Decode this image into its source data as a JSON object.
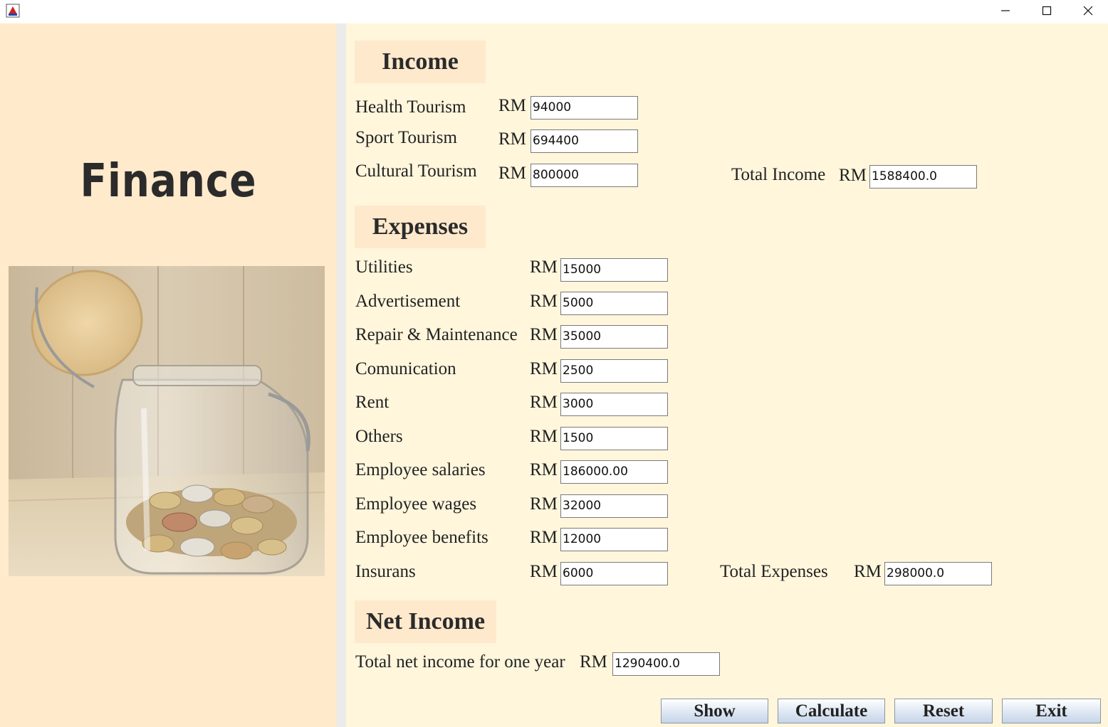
{
  "window": {
    "controls": {
      "minimize_icon": "minimize-icon",
      "maximize_icon": "maximize-icon",
      "close_icon": "close-icon"
    }
  },
  "sidebar": {
    "title": "Finance",
    "image": "coin-jar-photo"
  },
  "income": {
    "header": "Income",
    "currency": "RM",
    "rows": [
      {
        "label": "Health Tourism",
        "value": "94000"
      },
      {
        "label": "Sport Tourism",
        "value": "694400"
      },
      {
        "label": "Cultural Tourism",
        "value": "800000"
      }
    ],
    "total_label": "Total Income",
    "total_value": "1588400.0"
  },
  "expenses": {
    "header": "Expenses",
    "currency": "RM",
    "rows": [
      {
        "label": "Utilities",
        "value": "15000"
      },
      {
        "label": "Advertisement",
        "value": "5000"
      },
      {
        "label": "Repair & Maintenance",
        "value": "35000"
      },
      {
        "label": "Comunication",
        "value": "2500"
      },
      {
        "label": "Rent",
        "value": "3000"
      },
      {
        "label": "Others",
        "value": "1500"
      },
      {
        "label": "Employee salaries",
        "value": "186000.00"
      },
      {
        "label": "Employee wages",
        "value": "32000"
      },
      {
        "label": "Employee benefits",
        "value": "12000"
      },
      {
        "label": "Insurans",
        "value": "6000"
      }
    ],
    "total_label": "Total Expenses",
    "total_value": "298000.0"
  },
  "net_income": {
    "header": "Net Income",
    "currency": "RM",
    "label": "Total net income for one year",
    "value": "1290400.0"
  },
  "buttons": {
    "show": "Show",
    "calculate": "Calculate",
    "reset": "Reset",
    "exit": "Exit"
  },
  "colors": {
    "left_panel": "#ffeacc",
    "right_panel": "#fff6dc",
    "header_bg": "#ffe9cc"
  }
}
